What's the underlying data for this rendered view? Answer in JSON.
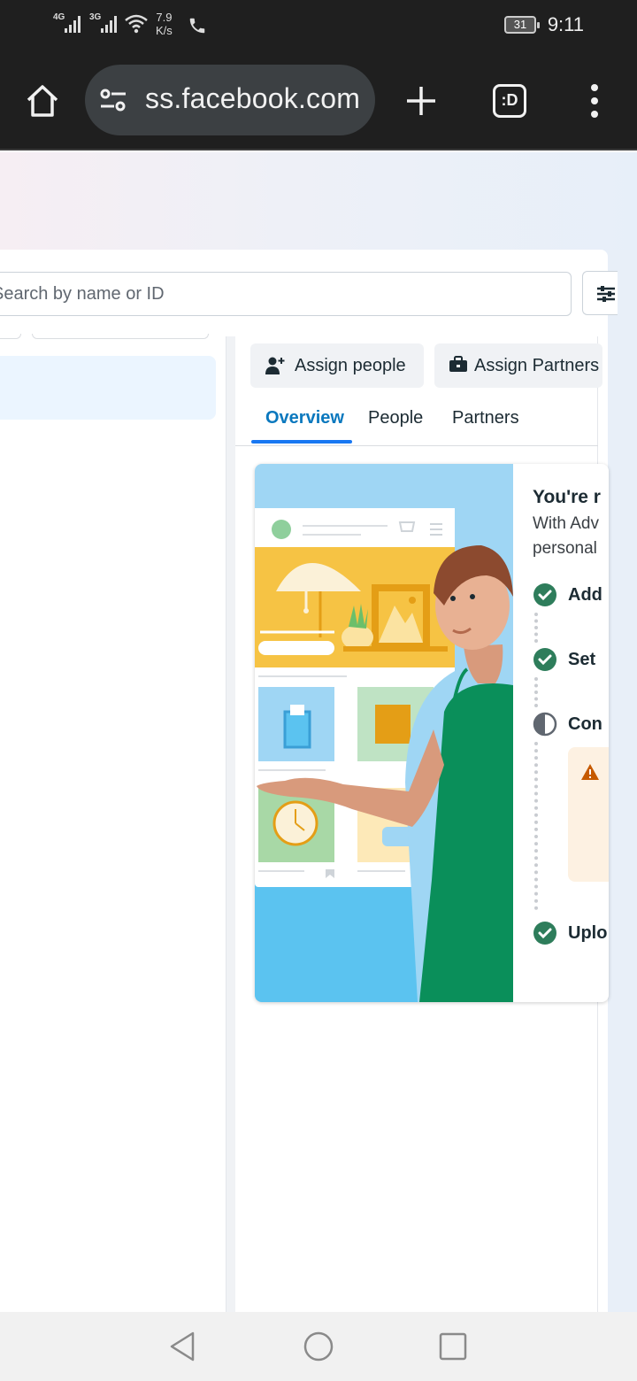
{
  "status_bar": {
    "net1": "4G",
    "net2": "3G",
    "speed_value": "7.9",
    "speed_unit": "K/s",
    "battery": "31",
    "time": "9:11"
  },
  "browser": {
    "url": "ss.facebook.com",
    "tabs_label": ":D"
  },
  "search": {
    "placeholder": "Search by name or ID"
  },
  "actions": {
    "assign_people": "Assign people",
    "assign_partners": "Assign Partners"
  },
  "tabs": {
    "overview": "Overview",
    "people": "People",
    "partners": "Partners"
  },
  "card": {
    "title": "You're r",
    "desc_line1": "With Adv",
    "desc_line2": "personal",
    "steps": [
      {
        "label": "Add",
        "status": "done"
      },
      {
        "label": "Set",
        "status": "done"
      },
      {
        "label": "Con",
        "status": "in-progress"
      },
      {
        "label": "Uplo",
        "status": "done"
      }
    ]
  },
  "colors": {
    "accent_blue": "#1877f2",
    "tab_active": "#0a78be",
    "success_green": "#2e7d5b",
    "warning_orange": "#c65a00"
  },
  "icons": {
    "home": "home-icon",
    "site_settings": "tune-icon",
    "new_tab": "plus-icon",
    "tabs": "tab-switcher-icon",
    "menu": "more-vert-icon",
    "filter": "filter-sliders-icon",
    "assign_people": "person-add-icon",
    "assign_partners": "briefcase-icon",
    "warning": "warning-icon",
    "nav_back": "triangle-back-icon",
    "nav_home": "circle-home-icon",
    "nav_recents": "square-recents-icon"
  }
}
